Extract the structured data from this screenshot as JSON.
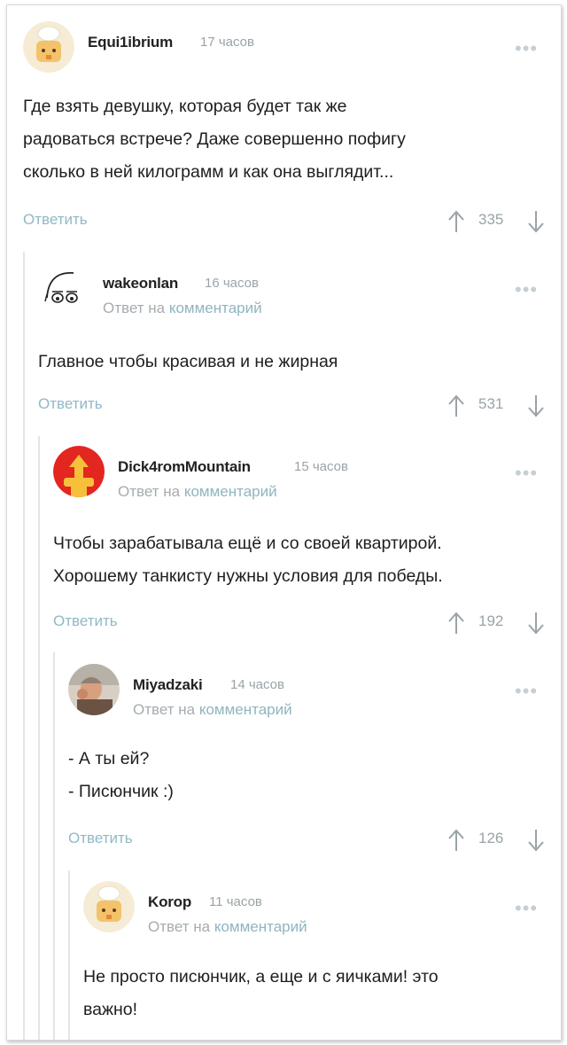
{
  "comments": [
    {
      "author": "Equi1ibrium",
      "time": "17 часов",
      "reply_prefix": "",
      "reply_link": "",
      "lines": [
        "Где взять девушку, которая будет так же",
        "радоваться встрече? Даже совершенно пофигу",
        "сколько в ней килограмм и как она выглядит..."
      ],
      "reply_label": "Ответить",
      "rating": "335",
      "avatar_icon": "cat-chef-avatar-icon"
    },
    {
      "author": "wakeonlan",
      "time": "16 часов",
      "reply_prefix": "Ответ на",
      "reply_link": "комментарий",
      "lines": [
        "Главное чтобы красивая и не жирная"
      ],
      "reply_label": "Ответить",
      "rating": "531",
      "avatar_icon": "sketch-face-avatar-icon"
    },
    {
      "author": "Dick4romMountain",
      "time": "15 часов",
      "reply_prefix": "Ответ на",
      "reply_link": "комментарий",
      "lines": [
        "Чтобы зарабатывала ещё и со своей квартирой.",
        "Хорошему танкисту нужны условия для победы."
      ],
      "reply_label": "Ответить",
      "rating": "192",
      "avatar_icon": "red-tank-avatar-icon"
    },
    {
      "author": "Miyadzaki",
      "time": "14 часов",
      "reply_prefix": "Ответ на",
      "reply_link": "комментарий",
      "lines": [
        "- А ты ей?",
        "- Писюнчик :)"
      ],
      "reply_label": "Ответить",
      "rating": "126",
      "avatar_icon": "photo-avatar-icon"
    },
    {
      "author": "Korop",
      "time": "11 часов",
      "reply_prefix": "Ответ на",
      "reply_link": "комментарий",
      "lines": [
        "Не просто писюнчик, а еще и с яичками! это",
        "важно!"
      ],
      "reply_label": "",
      "rating": "",
      "avatar_icon": "cat-chef-avatar-icon"
    }
  ],
  "menu_glyph": "•••",
  "colors": {
    "link": "#8fb9c6",
    "muted": "#9aa3a8",
    "thread_line": "#e3e6e8"
  }
}
